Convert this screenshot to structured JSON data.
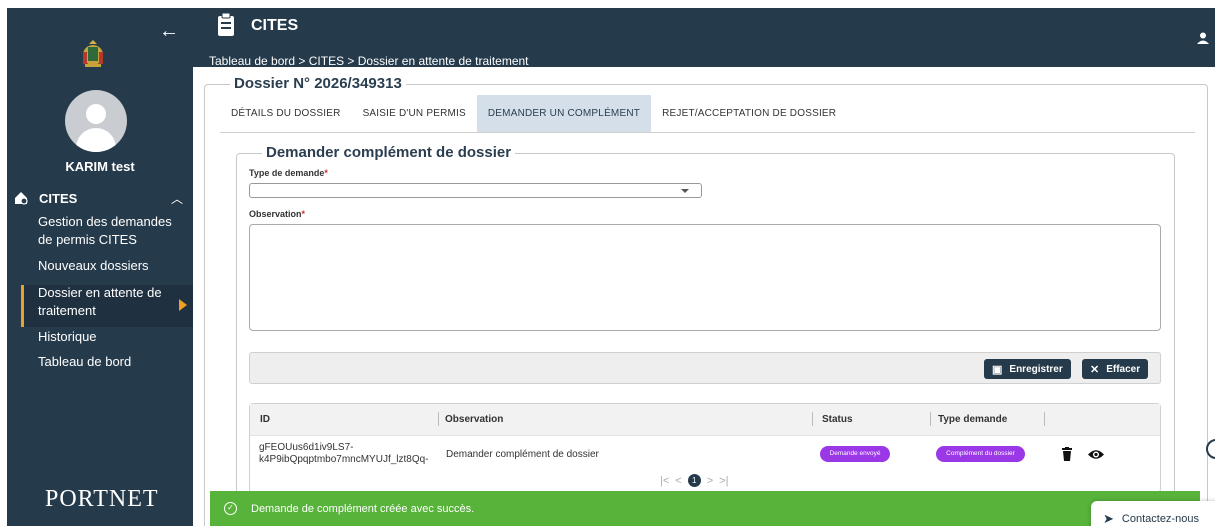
{
  "app": {
    "title": "CITES",
    "breadcrumb": "Tableau de bord > CITES > Dossier en attente de traitement",
    "brand": "PORTNET"
  },
  "user": {
    "name": "KARIM test"
  },
  "sidebar": {
    "section": "CITES",
    "items": [
      {
        "label": "Gestion des demandes de permis CITES"
      },
      {
        "label": "Nouveaux dossiers"
      },
      {
        "label": "Dossier en attente de traitement"
      },
      {
        "label": "Historique"
      },
      {
        "label": "Tableau de bord"
      }
    ]
  },
  "dossier": {
    "title": "Dossier N° 2026/349313"
  },
  "tabs": [
    {
      "label": "DÉTAILS DU DOSSIER"
    },
    {
      "label": "SAISIE D'UN PERMIS"
    },
    {
      "label": "DEMANDER UN COMPLÉMENT",
      "active": true
    },
    {
      "label": "REJET/ACCEPTATION DE DOSSIER"
    }
  ],
  "form": {
    "title": "Demander complément de dossier",
    "type_label": "Type de demande",
    "type_value": "",
    "observation_label": "Observation",
    "observation_value": "",
    "required_mark": "*"
  },
  "buttons": {
    "save": "Enregistrer",
    "clear": "Effacer"
  },
  "table": {
    "headers": [
      "ID",
      "Observation",
      "Status",
      "Type demande"
    ],
    "rows": [
      {
        "id_line1": "gFEOUus6d1iv9LS7-",
        "id_line2": "k4P9ibQpqptmbo7mncMYUJf_lzt8Qq-",
        "observation": "Demander complément de dossier",
        "status": "Demande envoyé",
        "type": "Complément du dossier"
      }
    ],
    "page": "1",
    "pager_first": "|<",
    "pager_prev": "<",
    "pager_next": ">",
    "pager_last": ">|"
  },
  "toast": {
    "message": "Demande de complément créée avec succès."
  },
  "contact": {
    "label": "Contactez-nous"
  },
  "colors": {
    "sidebar": "#253a4b",
    "accent": "#f0a020",
    "pill": "#9a38e8",
    "toast": "#57b33a"
  }
}
